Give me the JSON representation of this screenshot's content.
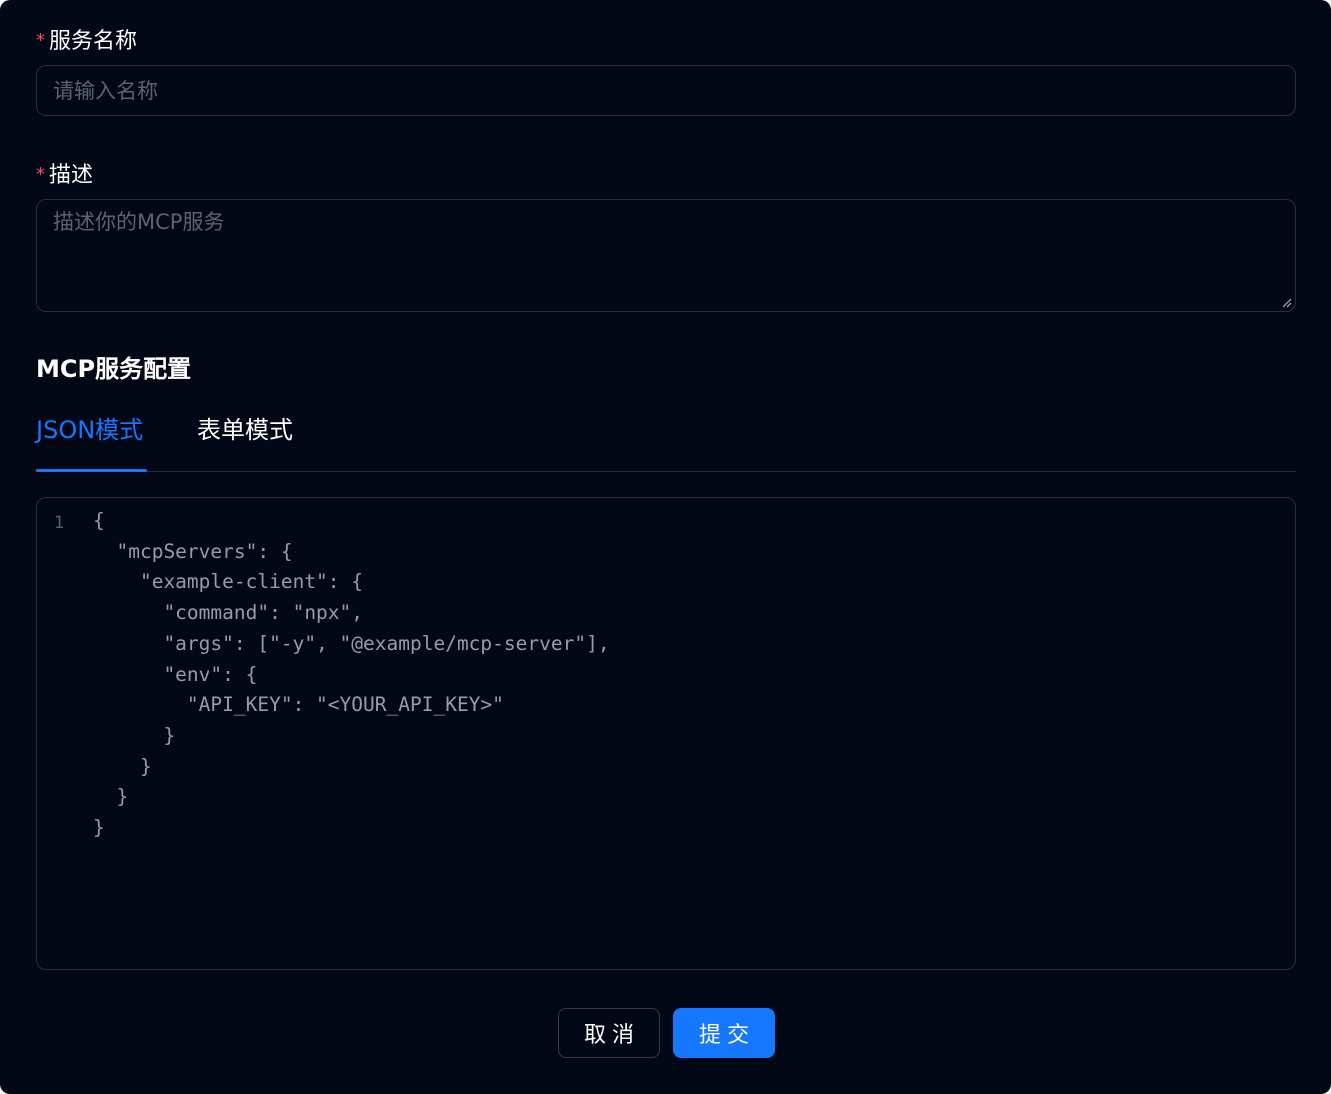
{
  "form": {
    "name_field": {
      "required_mark": "*",
      "label": "服务名称",
      "value": "",
      "placeholder": "请输入名称"
    },
    "description_field": {
      "required_mark": "*",
      "label": "描述",
      "value": "",
      "placeholder": "描述你的MCP服务"
    }
  },
  "config_section": {
    "title": "MCP服务配置",
    "tabs": [
      {
        "label": "JSON模式",
        "active": true
      },
      {
        "label": "表单模式",
        "active": false
      }
    ],
    "editor": {
      "line_number": "1",
      "content": "{\n  \"mcpServers\": {\n    \"example-client\": {\n      \"command\": \"npx\",\n      \"args\": [\"-y\", \"@example/mcp-server\"],\n      \"env\": {\n        \"API_KEY\": \"<YOUR_API_KEY>\"\n      }\n    }\n  }\n}"
    }
  },
  "actions": {
    "cancel_label": "取消",
    "submit_label": "提交"
  },
  "colors": {
    "background": "#030817",
    "accent": "#1677ff",
    "required": "#ff4d4f",
    "border": "#2a2f3d"
  }
}
